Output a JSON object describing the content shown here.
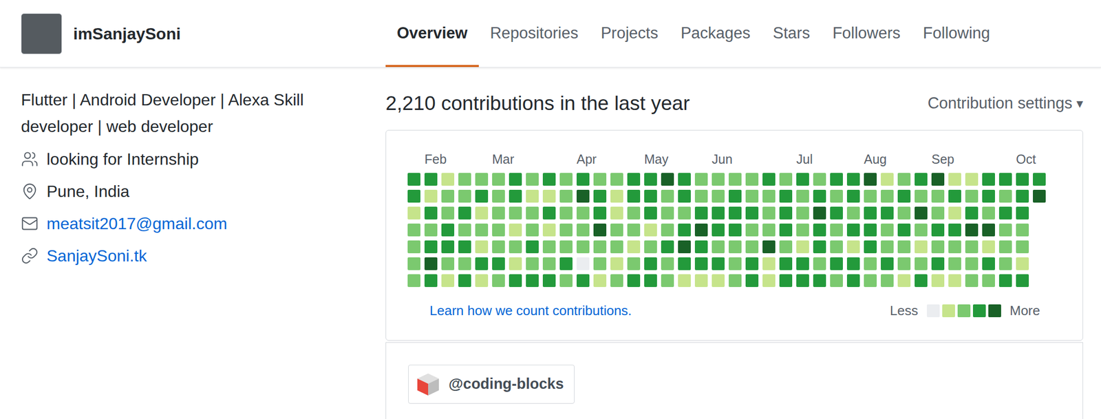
{
  "profile": {
    "username": "imSanjaySoni",
    "bio": "Flutter | Android Developer | Alexa Skill developer | web developer",
    "details": [
      {
        "kind": "status",
        "text": "looking for Internship",
        "link": false
      },
      {
        "kind": "location",
        "text": "Pune, India",
        "link": false
      },
      {
        "kind": "email",
        "text": "meatsit2017@gmail.com",
        "link": true
      },
      {
        "kind": "website",
        "text": "SanjaySoni.tk",
        "link": true
      }
    ]
  },
  "tabs": [
    {
      "label": "Overview",
      "selected": true
    },
    {
      "label": "Repositories",
      "selected": false
    },
    {
      "label": "Projects",
      "selected": false
    },
    {
      "label": "Packages",
      "selected": false
    },
    {
      "label": "Stars",
      "selected": false
    },
    {
      "label": "Followers",
      "selected": false
    },
    {
      "label": "Following",
      "selected": false
    }
  ],
  "contributions": {
    "title": "2,210 contributions in the last year",
    "settings": "Contribution settings",
    "settings_icon": "▾",
    "months": [
      {
        "label": "Feb",
        "week": 1
      },
      {
        "label": "Mar",
        "week": 5
      },
      {
        "label": "Apr",
        "week": 10
      },
      {
        "label": "May",
        "week": 14
      },
      {
        "label": "Jun",
        "week": 18
      },
      {
        "label": "Jul",
        "week": 23
      },
      {
        "label": "Aug",
        "week": 27
      },
      {
        "label": "Sep",
        "week": 31
      },
      {
        "label": "Oct",
        "week": 36
      }
    ],
    "levels": [
      [
        3,
        3,
        1,
        2,
        2,
        2,
        3,
        2,
        3,
        2,
        3,
        2,
        2,
        3,
        3,
        4,
        3,
        2,
        2,
        2,
        2,
        3,
        2,
        3,
        2,
        3,
        3,
        4,
        1,
        2,
        3,
        4,
        1,
        1,
        3,
        3,
        3,
        3
      ],
      [
        3,
        1,
        2,
        2,
        3,
        2,
        3,
        1,
        1,
        2,
        4,
        3,
        1,
        3,
        3,
        2,
        3,
        2,
        2,
        3,
        2,
        2,
        3,
        2,
        3,
        2,
        3,
        2,
        2,
        3,
        2,
        2,
        3,
        2,
        3,
        2,
        3,
        4
      ],
      [
        1,
        3,
        2,
        3,
        1,
        2,
        2,
        2,
        3,
        2,
        2,
        3,
        1,
        2,
        3,
        2,
        2,
        3,
        3,
        3,
        3,
        2,
        3,
        2,
        4,
        3,
        2,
        3,
        3,
        2,
        4,
        2,
        1,
        3,
        2,
        3,
        3
      ],
      [
        2,
        2,
        3,
        2,
        2,
        2,
        1,
        2,
        1,
        2,
        2,
        4,
        2,
        2,
        1,
        2,
        3,
        4,
        3,
        3,
        2,
        2,
        3,
        2,
        3,
        2,
        3,
        3,
        2,
        3,
        2,
        3,
        3,
        4,
        4,
        2,
        2
      ],
      [
        2,
        3,
        3,
        3,
        1,
        2,
        2,
        3,
        2,
        2,
        2,
        2,
        2,
        1,
        2,
        3,
        4,
        3,
        2,
        2,
        2,
        4,
        2,
        1,
        3,
        2,
        1,
        3,
        2,
        2,
        1,
        2,
        2,
        2,
        1,
        2,
        2
      ],
      [
        2,
        4,
        2,
        2,
        3,
        3,
        1,
        2,
        2,
        3,
        0,
        2,
        1,
        2,
        3,
        2,
        3,
        3,
        3,
        2,
        3,
        1,
        3,
        3,
        2,
        3,
        3,
        2,
        3,
        2,
        2,
        3,
        2,
        2,
        3,
        2,
        1
      ],
      [
        2,
        3,
        1,
        3,
        1,
        2,
        3,
        3,
        3,
        2,
        3,
        1,
        2,
        3,
        3,
        2,
        1,
        1,
        1,
        2,
        3,
        1,
        3,
        3,
        3,
        2,
        3,
        2,
        2,
        1,
        3,
        1,
        1,
        2,
        2,
        3,
        3
      ]
    ],
    "learn_link": "Learn how we count contributions.",
    "legend": {
      "less": "Less",
      "more": "More",
      "colors": [
        "#ebedf0",
        "#c6e48b",
        "#7bc96f",
        "#239a3b",
        "#196127"
      ]
    }
  },
  "organizations": [
    {
      "handle": "@coding-blocks"
    }
  ]
}
